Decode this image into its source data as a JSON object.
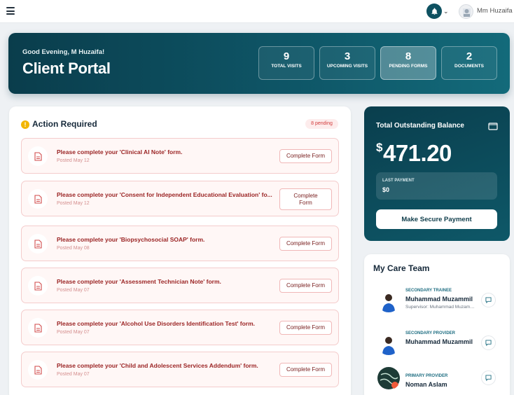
{
  "topbar": {
    "menu_icon": "hamburger-icon",
    "bell_icon": "bell-icon",
    "user_name": "Mm Huzaifa"
  },
  "hero": {
    "greeting": "Good Evening, M Huzaifa!",
    "title": "Client Portal",
    "stats": [
      {
        "value": "9",
        "label": "TOTAL VISITS"
      },
      {
        "value": "3",
        "label": "UPCOMING VISITS"
      },
      {
        "value": "8",
        "label": "PENDING FORMS"
      },
      {
        "value": "2",
        "label": "DOCUMENTS"
      }
    ]
  },
  "actions": {
    "title": "Action Required",
    "pending_badge": "8 pending",
    "button_label": "Complete Form",
    "tasks": [
      {
        "title": "Please complete your 'Clinical AI Note' form.",
        "date": "Posted May 12"
      },
      {
        "title": "Please complete your 'Consent for Independent Educational Evaluation' fo...",
        "date": "Posted May 12"
      },
      {
        "title": "Please complete your 'Biopsychosocial SOAP' form.",
        "date": "Posted May 08"
      },
      {
        "title": "Please complete your 'Assessment Technician Note' form.",
        "date": "Posted May 07"
      },
      {
        "title": "Please complete your 'Alcohol Use Disorders Identification Test' form.",
        "date": "Posted May 07"
      },
      {
        "title": "Please complete your 'Child and Adolescent Services Addendum' form.",
        "date": "Posted May 07"
      }
    ]
  },
  "balance": {
    "title": "Total Outstanding Balance",
    "currency": "$",
    "amount": "471.20",
    "last_payment_label": "LAST PAYMENT",
    "last_payment_value": "$0",
    "pay_button": "Make Secure Payment"
  },
  "team": {
    "title": "My Care Team",
    "members": [
      {
        "role": "SECONDARY TRAINEE",
        "name": "Muhammad Muzammil",
        "sub": "Supervisor: Muhammad Muzammil"
      },
      {
        "role": "SECONDARY PROVIDER",
        "name": "Muhammad Muzammil"
      },
      {
        "role": "PRIMARY PROVIDER",
        "name": "Noman Aslam"
      }
    ]
  },
  "colors": {
    "brand": "#0e5161",
    "accent_red": "#9b2525",
    "warning": "#f2b500"
  }
}
